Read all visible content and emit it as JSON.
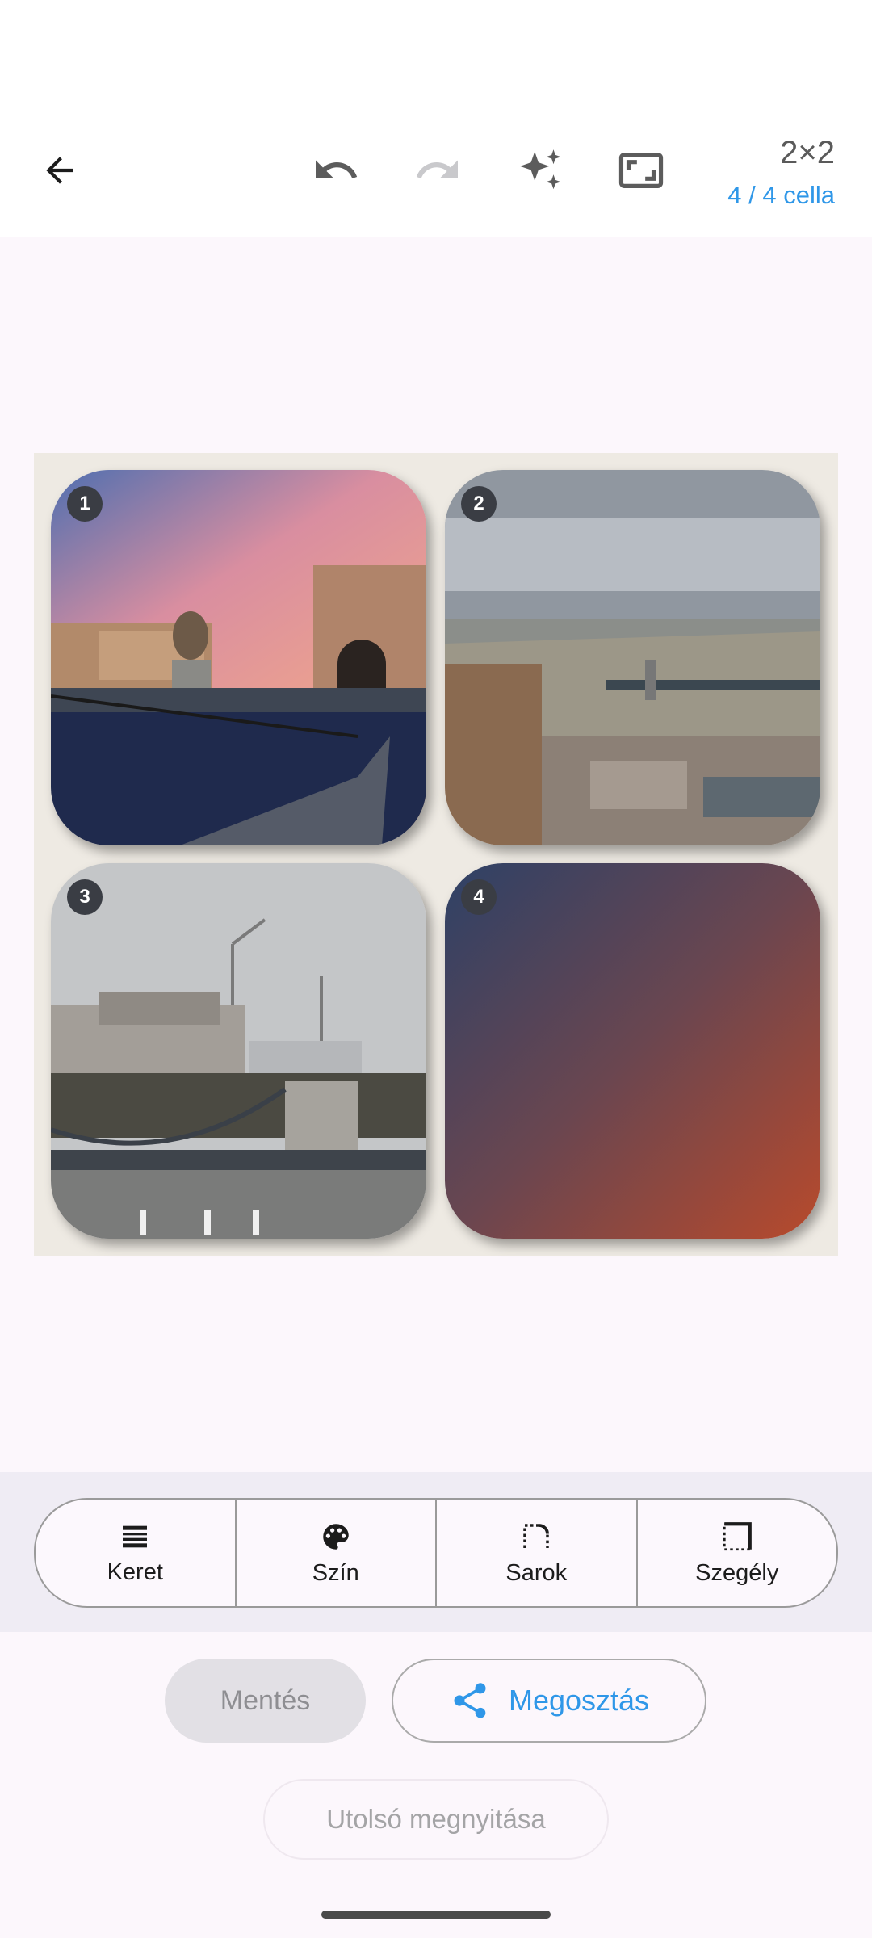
{
  "header": {
    "grid_label": "2×2",
    "cell_count": "4 / 4 cella",
    "icons": [
      "arrow-back-icon",
      "undo-icon",
      "redo-icon",
      "sparkles-icon",
      "aspect-ratio-icon"
    ]
  },
  "collage": {
    "cells": [
      {
        "number": "1",
        "subject": "chain-bridge-lion-statue-photo"
      },
      {
        "number": "2",
        "subject": "danube-river-aerial-photo"
      },
      {
        "number": "3",
        "subject": "chain-bridge-buda-castle-photo"
      },
      {
        "number": "4",
        "subject": "blue-to-orange-gradient"
      }
    ],
    "background_color": "#eeeae3"
  },
  "toolbar": {
    "items": [
      {
        "label": "Keret",
        "icon": "frame-icon"
      },
      {
        "label": "Szín",
        "icon": "palette-icon"
      },
      {
        "label": "Sarok",
        "icon": "corner-icon"
      },
      {
        "label": "Szegély",
        "icon": "border-icon"
      }
    ]
  },
  "actions": {
    "save_label": "Mentés",
    "share_label": "Megosztás",
    "open_last_label": "Utolsó megnyitása"
  },
  "colors": {
    "accent": "#2f97e8",
    "background": "#fcf7fc",
    "toolbar_bg": "#efecf4"
  }
}
